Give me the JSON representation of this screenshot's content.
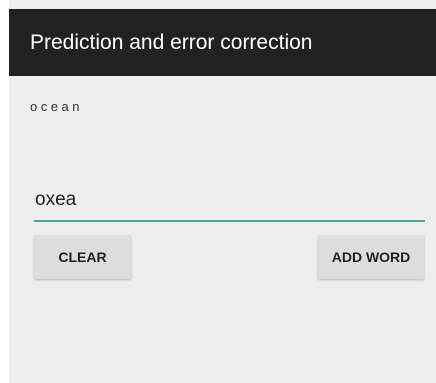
{
  "app": {
    "title": "Prediction and error correction"
  },
  "prediction": {
    "text": "ocean"
  },
  "input": {
    "value": "oxea"
  },
  "buttons": {
    "clear_label": "CLEAR",
    "add_word_label": "ADD WORD"
  },
  "colors": {
    "action_bar": "#212121",
    "background": "#eeeeee",
    "accent_underline": "#4ba69c",
    "button": "#dddddd"
  }
}
